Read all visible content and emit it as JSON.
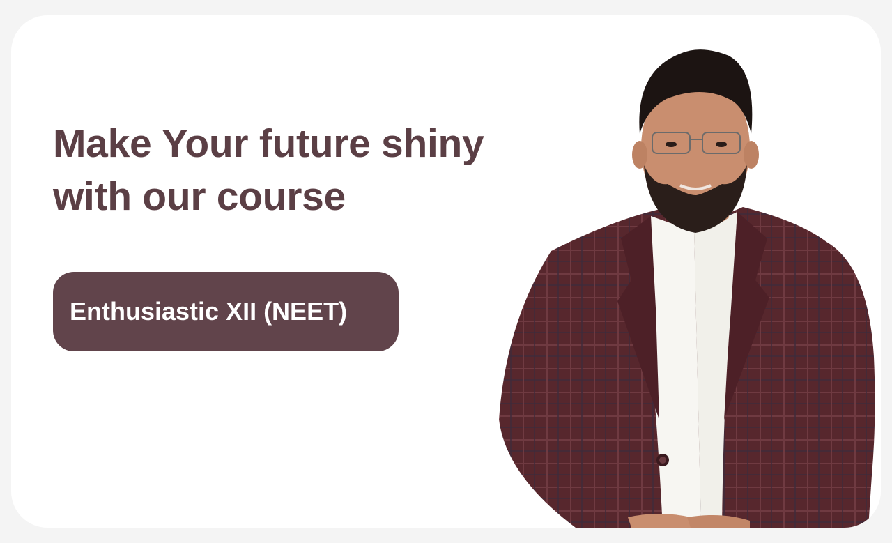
{
  "hero": {
    "headline_line1": "Make Your future shiny",
    "headline_line2": "with our course",
    "course_label": "Enthusiastic XII (NEET)"
  },
  "colors": {
    "page_background": "#f4f4f4",
    "card_background": "#ffffff",
    "headline_text": "#5b3f45",
    "button_background": "#61444b",
    "button_text": "#ffffff",
    "blazer": "#5a2a30"
  },
  "image": {
    "subject": "instructor portrait"
  }
}
